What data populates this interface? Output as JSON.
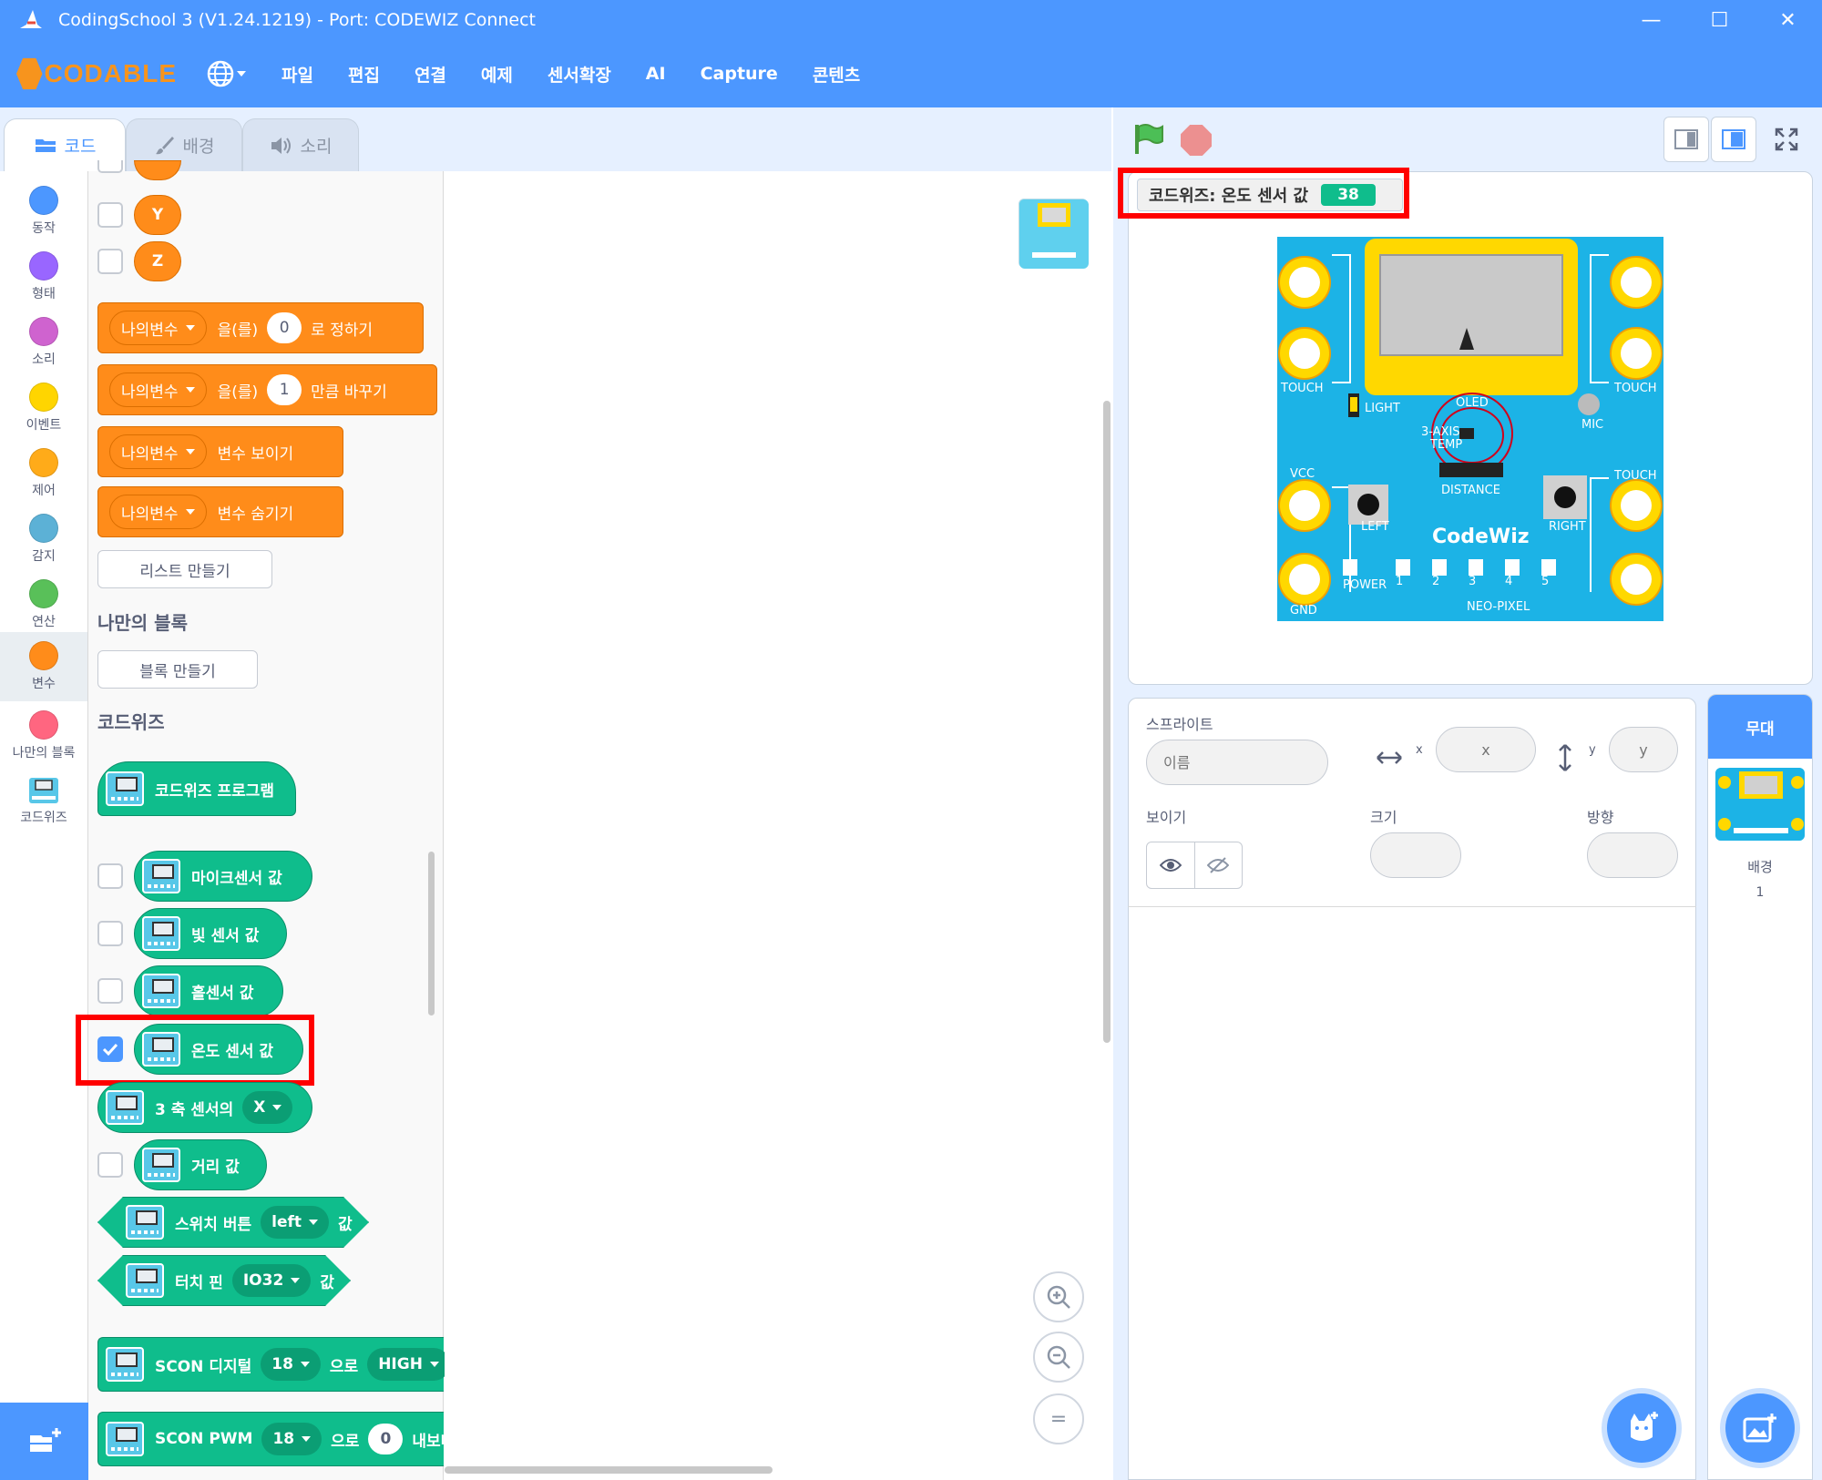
{
  "window": {
    "title": "CodingSchool 3 (V1.24.1219) - Port: CODEWIZ Connect",
    "controls": [
      "—",
      "☐",
      "✕"
    ]
  },
  "menubar": {
    "logo": "CODABLE",
    "items": [
      "파일",
      "편집",
      "연결",
      "예제",
      "센서확장",
      "AI",
      "Capture",
      "콘텐츠"
    ]
  },
  "tabs": [
    {
      "label": "코드",
      "icon": "code-icon"
    },
    {
      "label": "배경",
      "icon": "brush-icon"
    },
    {
      "label": "소리",
      "icon": "speaker-icon"
    }
  ],
  "categories": [
    {
      "label": "동작",
      "color": "#4c97ff"
    },
    {
      "label": "형태",
      "color": "#9966ff"
    },
    {
      "label": "소리",
      "color": "#cf63cf"
    },
    {
      "label": "이벤트",
      "color": "#ffd500"
    },
    {
      "label": "제어",
      "color": "#ffab19"
    },
    {
      "label": "감지",
      "color": "#5cb1d6"
    },
    {
      "label": "연산",
      "color": "#59c059"
    },
    {
      "label": "변수",
      "color": "#ff8c1a"
    },
    {
      "label": "나만의 블록",
      "color": "#ff6680"
    },
    {
      "label": "코드위즈",
      "color": ""
    }
  ],
  "palette": {
    "xyz": [
      "Y",
      "Z"
    ],
    "var_blocks": {
      "var_name": "나의변수",
      "set": {
        "mid": "을(를)",
        "value": "0",
        "tail": "로 정하기"
      },
      "change": {
        "mid": "을(를)",
        "value": "1",
        "tail": "만큼 바꾸기"
      },
      "show": "변수 보이기",
      "hide": "변수 숨기기"
    },
    "make_list": "리스트 만들기",
    "my_blocks_heading": "나만의 블록",
    "make_block": "블록 만들기",
    "codewiz_heading": "코드위즈",
    "codewiz_program": "코드위즈 프로그램",
    "sensor_blocks": {
      "mic": "마이크센서 값",
      "light": "빛 센서 값",
      "hall": "홀센서 값",
      "temp": "온도 센서 값",
      "axis": "3 축 센서의",
      "axis_dd": "X",
      "distance": "거리 값",
      "switch": "스위치 버튼",
      "switch_dd": "left",
      "switch_tail": "값",
      "touch": "터치 핀",
      "touch_dd": "IO32",
      "touch_tail": "값",
      "scon_digital": "SCON 디지털",
      "scon_digital_pin": "18",
      "scon_digital_mid": "으로",
      "scon_digital_val": "HIGH",
      "scon_pwm": "SCON PWM",
      "scon_pwm_pin": "18",
      "scon_pwm_mid": "으로",
      "scon_pwm_val": "0",
      "scon_pwm_tail": "내보내"
    }
  },
  "zoom": {
    "in": "+",
    "out": "−",
    "reset": "="
  },
  "stage": {
    "monitor_label": "코드위즈: 온도 센서 값",
    "monitor_value": "38",
    "board_labels": {
      "touch_left": "TOUCH",
      "touch_right": "TOUCH",
      "touch_right2": "TOUCH",
      "light": "LIGHT",
      "oled": "OLED",
      "mic": "MIC",
      "axis": "3-AXIS",
      "temp": "TEMP",
      "vcc": "VCC",
      "distance": "DISTANCE",
      "left": "LEFT",
      "right": "RIGHT",
      "brand": "CodeWiz",
      "power": "POWER",
      "gnd": "GND",
      "neo": "NEO-PIXEL",
      "n1": "1",
      "n2": "2",
      "n3": "3",
      "n4": "4",
      "n5": "5"
    }
  },
  "sprite_info": {
    "sprite_label": "스프라이트",
    "name_placeholder": "이름",
    "x_label": "x",
    "x_placeholder": "x",
    "y_label": "y",
    "y_placeholder": "y",
    "show_label": "보이기",
    "size_label": "크기",
    "direction_label": "방향"
  },
  "stage_column": {
    "title": "무대",
    "backdrop_label": "배경",
    "backdrop_count": "1"
  },
  "colors": {
    "accent": "#4c97ff",
    "variables": "#ff8c1a",
    "extension": "#0fbd8c",
    "highlight": "#ff0000"
  }
}
